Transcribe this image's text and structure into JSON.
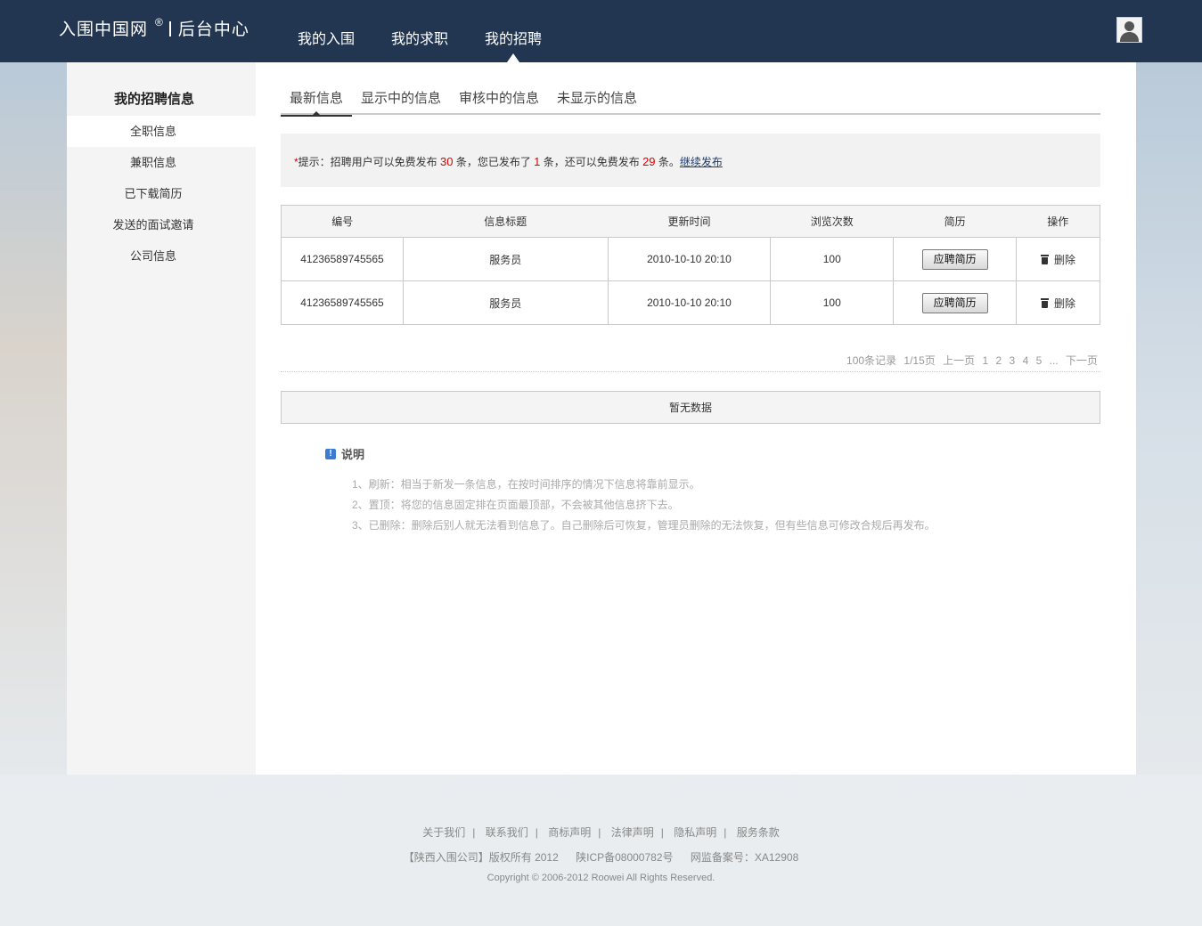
{
  "header": {
    "logo_text": "入围中国网",
    "logo_reg": "®",
    "logo_sub": "后台中心",
    "nav": [
      "我的入围",
      "我的求职",
      "我的招聘"
    ],
    "active_nav": 2
  },
  "sidebar": {
    "title": "我的招聘信息",
    "items": [
      "全职信息",
      "兼职信息",
      "已下载简历",
      "发送的面试邀请",
      "公司信息"
    ],
    "active_index": 0
  },
  "tabs": [
    "最新信息",
    "显示中的信息",
    "审核中的信息",
    "未显示的信息"
  ],
  "notice": {
    "star": "*",
    "p1": "提示：招聘用户可以免费发布 ",
    "n1": "30",
    "p2": " 条，您已发布了 ",
    "n2": "1",
    "p3": " 条，还可以免费发布 ",
    "n3": "29",
    "p4": " 条。",
    "link": "继续发布"
  },
  "table": {
    "headers": [
      "编号",
      "信息标题",
      "更新时间",
      "浏览次数",
      "简历",
      "操作"
    ],
    "rows": [
      {
        "id": "41236589745565",
        "title": "服务员",
        "time": "2010-10-10 20:10",
        "views": "100",
        "resume_btn": "应聘简历",
        "action": "删除"
      },
      {
        "id": "41236589745565",
        "title": "服务员",
        "time": "2010-10-10 20:10",
        "views": "100",
        "resume_btn": "应聘简历",
        "action": "删除"
      }
    ]
  },
  "pager": {
    "records": "100条记录",
    "pages": "1/15页",
    "prev": "上一页",
    "numbers": [
      "1",
      "2",
      "3",
      "4",
      "5"
    ],
    "ellipsis": "...",
    "next": "下一页"
  },
  "nodata": "暂无数据",
  "explain": {
    "title": "说明",
    "icon": "info-icon",
    "items": [
      "1、刷新：相当于新发一条信息，在按时间排序的情况下信息将靠前显示。",
      "2、置顶：将您的信息固定排在页面最顶部，不会被其他信息挤下去。",
      "3、已删除：删除后别人就无法看到信息了。自己删除后可恢复，管理员删除的无法恢复，但有些信息可修改合规后再发布。"
    ]
  },
  "footer": {
    "links": [
      "关于我们",
      "联系我们",
      "商标声明",
      "法律声明",
      "隐私声明",
      "服务条款"
    ],
    "sep": "|",
    "copyright_cn": "【陕西入围公司】版权所有 2012",
    "icp": "陕ICP备08000782号",
    "record": "网监备案号：XA12908",
    "copyright_en": "Copyright © 2006-2012 Roowei All Rights Reserved."
  },
  "colors": {
    "header_bg": "#223651",
    "highlight_red": "#dd0000",
    "sidebar_bg": "#f4f4f4"
  }
}
